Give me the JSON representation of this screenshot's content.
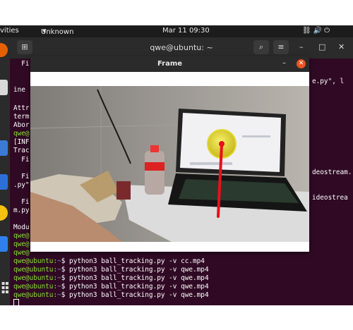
{
  "topbar": {
    "activities": "vities",
    "app_menu": "Unknown",
    "clock": "Mar 11  09:30",
    "indicators": "⛓🔊⏻"
  },
  "terminal": {
    "title": "qwe@ubuntu: ~",
    "lines": [
      "  Fi",
      "ine",
      "Attr",
      "term",
      "Abor",
      "qwe@",
      "[INF",
      "Trac",
      "  Fi",
      "  Fi",
      ".py\"",
      "  Fi",
      "m.py",
      "Modu"
    ],
    "right_fragments": [
      "e.py\", l",
      "deostream.",
      "ideostrea"
    ],
    "prompt_user": "qwe@ubuntu:",
    "prompt_path": "~",
    "prompt_symbol": "$",
    "short_prompts": [
      "qwe@",
      "qwe@",
      "qwe@"
    ],
    "commands": [
      " python3 ball_tracking.py -v cc.mp4",
      " python3 ball_tracking.py -v qwe.mp4",
      " python3 ball_tracking.py -v qwe.mp4",
      " python3 ball_tracking.py -v qwe.mp4",
      " python3 ball_tracking.py -v qwe.mp4"
    ]
  },
  "frame": {
    "title": "Frame"
  },
  "colors": {
    "terminal_bg": "#300a24",
    "close_button": "#e95420",
    "prompt": "#8ae234",
    "path": "#729fcf",
    "tracking_trail": "#e8101a",
    "ball": "#e7e32a"
  }
}
